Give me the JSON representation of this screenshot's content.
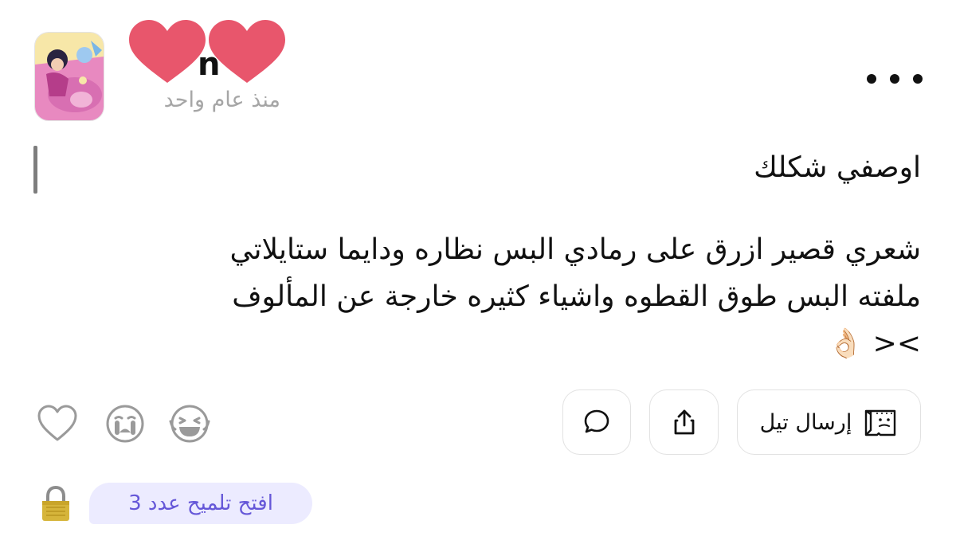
{
  "post": {
    "author": {
      "name_visible_fragment": "n",
      "time_ago": "منذ عام واحد"
    },
    "question": "اوصفي شكلك",
    "answer_lines": [
      "شعري قصير ازرق على رمادي البس نظاره ودايما ستايلاتي",
      "ملفته البس طوق القطوه واشياء كثيره خارجة عن المألوف",
      ">< 👌🏻"
    ]
  },
  "reactions": [
    {
      "icon": "heart-outline-icon"
    },
    {
      "icon": "crying-face-icon"
    },
    {
      "icon": "laughing-face-icon"
    }
  ],
  "actions": {
    "send_tell_label": "إرسال تيل",
    "send_tell_icon": "tell-card-icon",
    "share_icon": "share-icon",
    "comment_icon": "comment-bubble-icon"
  },
  "hint": {
    "label": "افتح تلميح عدد 3",
    "icon": "lock-icon"
  },
  "colors": {
    "accent": "#6557d8",
    "hint_bg": "#ecebff",
    "muted": "#a6a6a6",
    "heart_sticker": "#e8566c"
  }
}
